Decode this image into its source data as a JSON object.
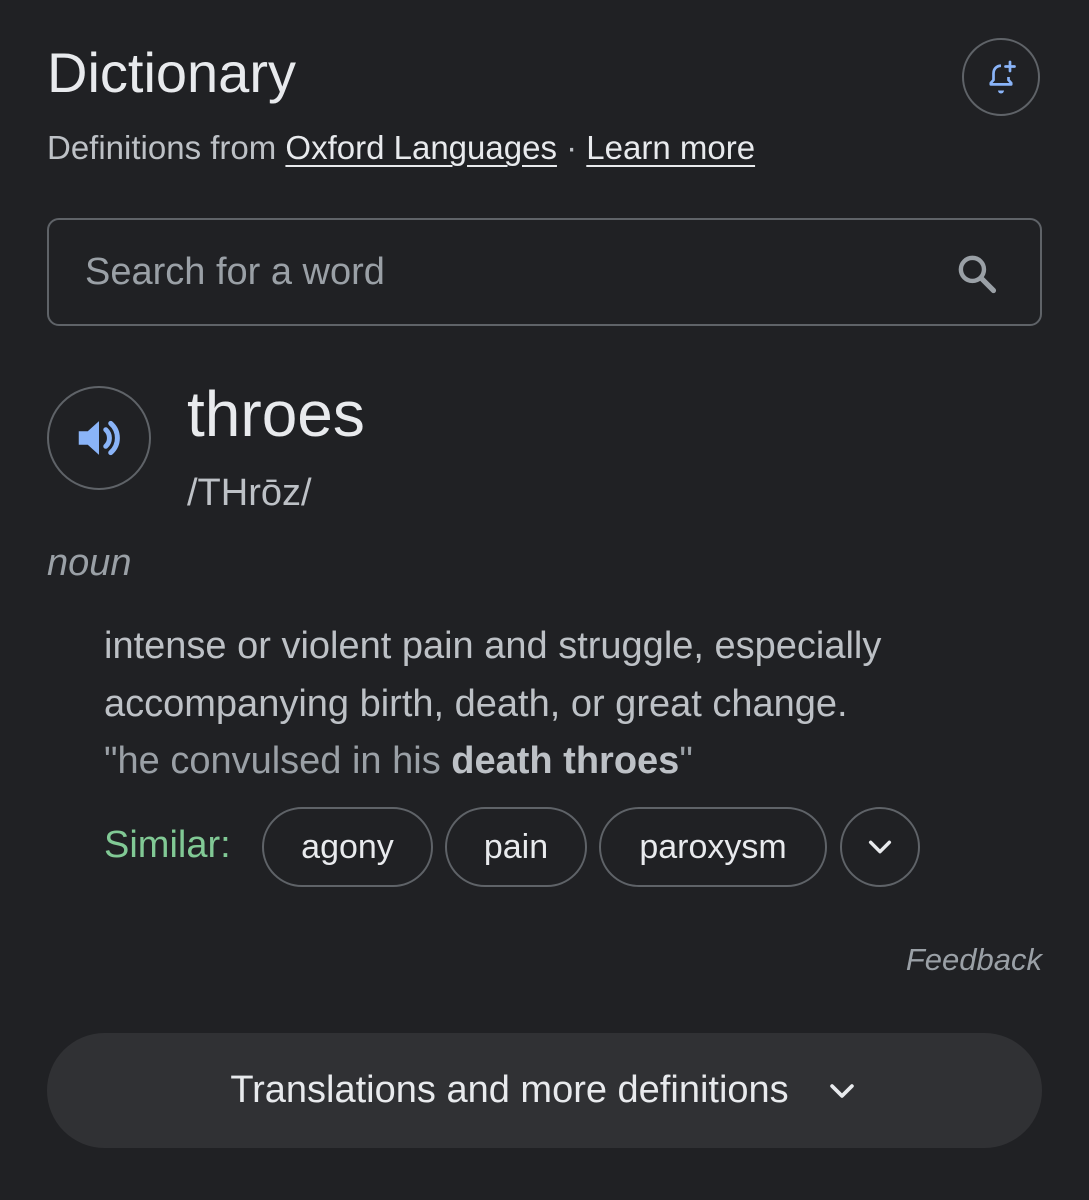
{
  "header": {
    "title": "Dictionary",
    "source_prefix": "Definitions from",
    "source_link": "Oxford Languages",
    "separator": "·",
    "learn_more": "Learn more"
  },
  "search": {
    "placeholder": "Search for a word"
  },
  "entry": {
    "word": "throes",
    "phonetic": "/THrōz/",
    "part_of_speech": "noun",
    "definition": "intense or violent pain and struggle, especially accompanying birth, death, or great change.",
    "example_prefix": "\"he convulsed in his ",
    "example_bold": "death throes",
    "example_suffix": "\""
  },
  "similar": {
    "label": "Similar:",
    "chips": [
      "agony",
      "pain",
      "paroxysm"
    ]
  },
  "footer": {
    "feedback": "Feedback",
    "more_button": "Translations and more definitions"
  },
  "colors": {
    "background": "#202124",
    "accent_blue": "#8ab4f8",
    "similar_green": "#81c995",
    "border": "#5f6368"
  },
  "icons": {
    "bell": "add-alert-bell-icon",
    "search": "search-icon",
    "speaker": "speaker-icon",
    "expand_chips": "chevron-down-icon",
    "more": "chevron-down-icon"
  }
}
